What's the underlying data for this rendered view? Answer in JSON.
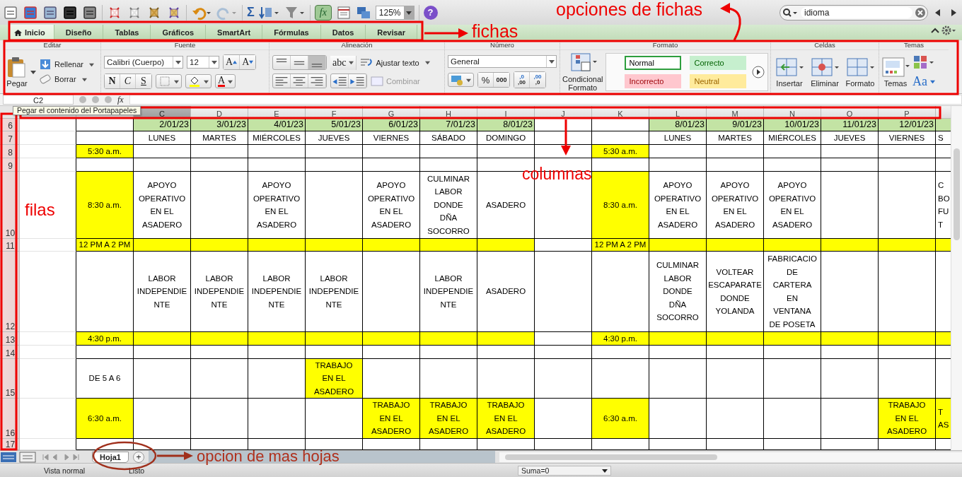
{
  "toolbar": {
    "sum": "Σ",
    "function": "fx",
    "zoom": "125%",
    "help": "?",
    "search": {
      "value": "idioma"
    }
  },
  "tabs": [
    {
      "label": "Inicio",
      "selected": true
    },
    {
      "label": "Diseño",
      "selected": false
    },
    {
      "label": "Tablas",
      "selected": false
    },
    {
      "label": "Gráficos",
      "selected": false
    },
    {
      "label": "SmartArt",
      "selected": false
    },
    {
      "label": "Fórmulas",
      "selected": false
    },
    {
      "label": "Datos",
      "selected": false
    },
    {
      "label": "Revisar",
      "selected": false
    }
  ],
  "ribbon": {
    "editar": {
      "title": "Editar",
      "paste": "Pegar",
      "fill": "Rellenar",
      "clear": "Borrar"
    },
    "fuente": {
      "title": "Fuente",
      "font": "Calibri (Cuerpo)",
      "size": "12",
      "grow": "A",
      "shrink": "A",
      "styles": [
        "N",
        "C",
        "S"
      ],
      "color_letter": "A"
    },
    "alineacion": {
      "title": "Alineación",
      "orientation": "abc",
      "wrap": "Ajustar texto",
      "merge": {
        "label": "Combinar",
        "disabled": true
      }
    },
    "numero": {
      "title": "Número",
      "format": "General",
      "percent": "%",
      "thousands": "000",
      "decimals": [
        {
          "top": ",0",
          "bottom": ",00"
        },
        {
          "top": ",00",
          "bottom": ",0"
        }
      ]
    },
    "formato": {
      "title": "Formato",
      "conditional": "Condicional\nFormato",
      "styles": [
        {
          "label": "Normal",
          "kind": "normal"
        },
        {
          "label": "Correcto",
          "kind": "good"
        },
        {
          "label": "Incorrecto",
          "kind": "bad"
        },
        {
          "label": "Neutral",
          "kind": "neutral"
        }
      ]
    },
    "celdas": {
      "title": "Celdas",
      "buttons": [
        "Insertar",
        "Eliminar",
        "Formato"
      ]
    },
    "temas": {
      "title": "Temas",
      "themes": "Temas",
      "fonts": "Aa"
    }
  },
  "formula_bar": {
    "name_box": "C2",
    "function": "fx"
  },
  "tooltip": "Pegar el contenido del Portapapeles",
  "columns": [
    {
      "selected": false
    },
    {
      "selected": false
    },
    {
      "label": "C",
      "selected": true
    },
    {
      "label": "D",
      "selected": false
    },
    {
      "label": "E",
      "selected": false
    },
    {
      "label": "F",
      "selected": false
    },
    {
      "label": "G",
      "selected": false
    },
    {
      "label": "H",
      "selected": false
    },
    {
      "label": "I",
      "selected": false
    },
    {
      "label": "J",
      "selected": false
    },
    {
      "label": "K",
      "selected": false
    },
    {
      "label": "L",
      "selected": false
    },
    {
      "label": "M",
      "selected": false
    },
    {
      "label": "N",
      "selected": false
    },
    {
      "label": "O",
      "selected": false
    },
    {
      "label": "P",
      "selected": false
    }
  ],
  "rows": [
    {
      "label": "6",
      "kind": "dates",
      "cells": [
        {},
        {},
        {
          "text": "2/01/23",
          "color": "#c3e3a4"
        },
        {
          "text": "3/01/23",
          "color": "#c3e3a4"
        },
        {
          "text": "4/01/23",
          "color": "#c3e3a4"
        },
        {
          "text": "5/01/23",
          "color": "#c3e3a4"
        },
        {
          "text": "6/01/23",
          "color": "#c3e3a4"
        },
        {
          "text": "7/01/23",
          "color": "#c3e3a4"
        },
        {
          "text": "8/01/23",
          "color": "#c3e3a4"
        },
        {},
        {},
        {
          "text": "8/01/23",
          "color": "#c3e3a4"
        },
        {
          "text": "9/01/23",
          "color": "#c3e3a4"
        },
        {
          "text": "10/01/23",
          "color": "#c3e3a4"
        },
        {
          "text": "11/01/23",
          "color": "#c3e3a4"
        },
        {
          "text": "12/01/23",
          "color": "#c3e3a4"
        },
        {
          "color": "#c3e3a4"
        }
      ]
    },
    {
      "label": "7",
      "kind": "schedule",
      "cells": [
        {},
        {},
        {
          "text": "LUNES"
        },
        {
          "text": "MARTES"
        },
        {
          "text": "MIÉRCOLES"
        },
        {
          "text": "JUEVES"
        },
        {
          "text": "VIERNES"
        },
        {
          "text": "SÁBADO"
        },
        {
          "text": "DOMINGO"
        },
        {},
        {},
        {
          "text": "LUNES"
        },
        {
          "text": "MARTES"
        },
        {
          "text": "MIÉRCOLES"
        },
        {
          "text": "JUEVES"
        },
        {
          "text": "VIERNES"
        },
        {
          "text": "S"
        }
      ]
    },
    {
      "label": "8",
      "kind": "schedule",
      "cells": [
        {},
        {
          "text": "5:30 a.m.",
          "color": "#ffff00"
        },
        {},
        {},
        {},
        {},
        {},
        {},
        {},
        {},
        {
          "text": "5:30 a.m.",
          "color": "#ffff00"
        },
        {},
        {},
        {},
        {},
        {},
        {}
      ]
    },
    {
      "label": "9",
      "kind": "schedule",
      "cells": [
        {},
        {},
        {},
        {},
        {},
        {},
        {},
        {},
        {},
        {},
        {},
        {},
        {},
        {},
        {},
        {},
        {}
      ]
    },
    {
      "label": "10",
      "kind": "schedule",
      "cells": [
        {},
        {
          "text": "8:30 a.m.",
          "color": "#ffff00"
        },
        {
          "text": "APOYO\nOPERATIVO\nEN EL\nASADERO"
        },
        {},
        {
          "text": "APOYO\nOPERATIVO\nEN EL\nASADERO"
        },
        {},
        {
          "text": "APOYO\nOPERATIVO\nEN EL\nASADERO"
        },
        {
          "text": "CULMINAR\nLABOR\nDONDE\nDÑA\nSOCORRO"
        },
        {
          "text": "ASADERO"
        },
        {},
        {
          "text": "8:30 a.m.",
          "color": "#ffff00"
        },
        {
          "text": "APOYO\nOPERATIVO\nEN EL\nASADERO"
        },
        {
          "text": "APOYO\nOPERATIVO\nEN EL\nASADERO"
        },
        {
          "text": "APOYO\nOPERATIVO\nEN EL\nASADERO"
        },
        {},
        {},
        {
          "text": "C\nBO\nFU\nT"
        }
      ]
    },
    {
      "label": "11",
      "kind": "schedule",
      "cells": [
        {},
        {
          "text": "12 PM A 2 PM",
          "color": "#ffff00"
        },
        {
          "color": "#ffff00"
        },
        {
          "color": "#ffff00"
        },
        {
          "color": "#ffff00"
        },
        {
          "color": "#ffff00"
        },
        {
          "color": "#ffff00"
        },
        {
          "color": "#ffff00"
        },
        {
          "color": "#ffff00"
        },
        {},
        {
          "text": "12 PM A 2 PM",
          "color": "#ffff00"
        },
        {
          "color": "#ffff00"
        },
        {
          "color": "#ffff00"
        },
        {
          "color": "#ffff00"
        },
        {
          "color": "#ffff00"
        },
        {
          "color": "#ffff00"
        },
        {
          "color": "#ffff00"
        }
      ]
    },
    {
      "label": "12",
      "kind": "schedule",
      "cells": [
        {},
        {},
        {
          "text": "LABOR\nINDEPENDIE\nNTE"
        },
        {
          "text": "LABOR\nINDEPENDIE\nNTE"
        },
        {
          "text": "LABOR\nINDEPENDIE\nNTE"
        },
        {
          "text": "LABOR\nINDEPENDIE\nNTE"
        },
        {},
        {
          "text": "LABOR\nINDEPENDIE\nNTE"
        },
        {
          "text": "ASADERO"
        },
        {},
        {},
        {
          "text": "CULMINAR\nLABOR\nDONDE\nDÑA\nSOCORRO"
        },
        {
          "text": "VOLTEAR\nESCAPARATE\nDONDE\nYOLANDA"
        },
        {
          "text": "FABRICACIO\nDE\nCARTERA\nEN\nVENTANA\nDE POSETA"
        },
        {},
        {},
        {}
      ]
    },
    {
      "label": "13",
      "kind": "schedule",
      "cells": [
        {},
        {
          "text": "4:30 p.m.",
          "color": "#ffff00"
        },
        {
          "color": "#ffff00"
        },
        {
          "color": "#ffff00"
        },
        {
          "color": "#ffff00"
        },
        {
          "color": "#ffff00"
        },
        {
          "color": "#ffff00"
        },
        {
          "color": "#ffff00"
        },
        {
          "color": "#ffff00"
        },
        {},
        {
          "text": "4:30 p.m.",
          "color": "#ffff00"
        },
        {
          "color": "#ffff00"
        },
        {
          "color": "#ffff00"
        },
        {
          "color": "#ffff00"
        },
        {
          "color": "#ffff00"
        },
        {
          "color": "#ffff00"
        },
        {
          "color": "#ffff00"
        }
      ]
    },
    {
      "label": "14",
      "kind": "schedule",
      "cells": [
        {},
        {},
        {},
        {},
        {},
        {},
        {},
        {},
        {},
        {},
        {},
        {},
        {},
        {},
        {},
        {},
        {}
      ]
    },
    {
      "label": "15",
      "kind": "schedule",
      "cells": [
        {},
        {
          "text": "DE 5 A 6"
        },
        {},
        {},
        {},
        {
          "text": "TRABAJO\nEN EL\nASADERO",
          "color": "#ffff00"
        },
        {},
        {},
        {},
        {},
        {},
        {},
        {},
        {},
        {},
        {},
        {}
      ]
    },
    {
      "label": "16",
      "kind": "schedule",
      "cells": [
        {},
        {
          "text": "6:30 a.m.",
          "color": "#ffff00"
        },
        {},
        {},
        {},
        {},
        {
          "text": "TRABAJO\nEN EL\nASADERO",
          "color": "#ffff00"
        },
        {
          "text": "TRABAJO\nEN EL\nASADERO",
          "color": "#ffff00"
        },
        {
          "text": "TRABAJO\nEN EL\nASADERO",
          "color": "#ffff00"
        },
        {},
        {
          "text": "6:30 a.m.",
          "color": "#ffff00"
        },
        {},
        {},
        {},
        {},
        {
          "text": "TRABAJO\nEN EL\nASADERO",
          "color": "#ffff00"
        },
        {
          "text": "T\nAS",
          "color": "#ffff00"
        }
      ]
    },
    {
      "label": "17",
      "kind": "schedule",
      "cells": [
        {},
        {},
        {},
        {},
        {},
        {},
        {},
        {},
        {},
        {},
        {},
        {},
        {},
        {},
        {},
        {},
        {}
      ]
    }
  ],
  "sheets": [
    {
      "label": "Hoja1",
      "selected": true
    }
  ],
  "add_sheet": "+",
  "status_bar": {
    "view": "Vista normal",
    "status": "Listo",
    "sum": "Suma=0"
  },
  "annotations": [
    {
      "text": "opciones de fichas"
    },
    {
      "text": "fichas"
    },
    {
      "text": "columnas"
    },
    {
      "text": "filas"
    },
    {
      "text": "opcion de mas hojas"
    }
  ]
}
